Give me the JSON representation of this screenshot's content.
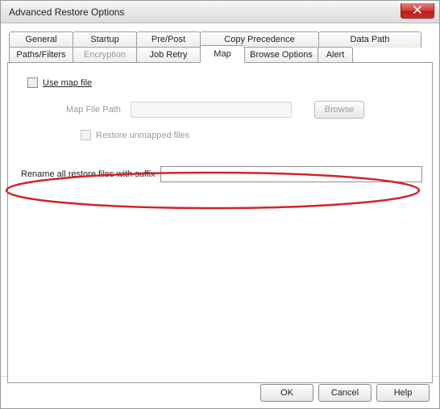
{
  "window": {
    "title": "Advanced Restore Options"
  },
  "tabs": {
    "row1": [
      {
        "label": "General"
      },
      {
        "label": "Startup"
      },
      {
        "label": "Pre/Post"
      },
      {
        "label": "Copy Precedence"
      },
      {
        "label": "Data Path"
      }
    ],
    "row2": [
      {
        "label": "Paths/Filters"
      },
      {
        "label": "Encryption"
      },
      {
        "label": "Job Retry"
      },
      {
        "label": "Map"
      },
      {
        "label": "Browse Options"
      },
      {
        "label": "Alert"
      }
    ],
    "active": "Map"
  },
  "map_page": {
    "use_map_file": "Use map file",
    "map_file_path_label": "Map File Path",
    "map_file_path_value": "",
    "browse_button": "Browse",
    "restore_unmapped": "Restore unmapped files",
    "rename_label": "Rename all restore files with suffix",
    "rename_value": ""
  },
  "footer": {
    "ok": "OK",
    "cancel": "Cancel",
    "help": "Help"
  }
}
